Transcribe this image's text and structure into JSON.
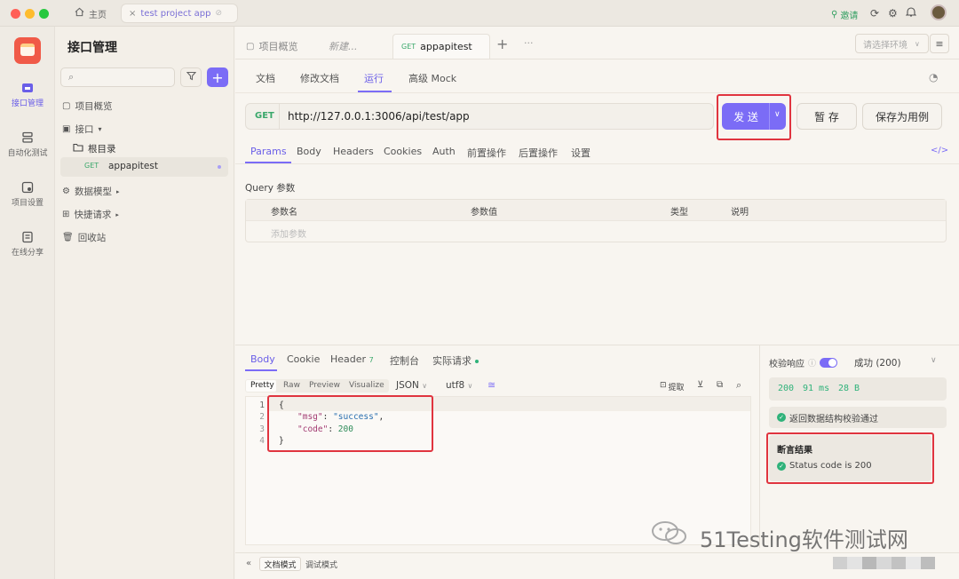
{
  "window": {
    "tab_home": "主页",
    "tab_project": "test project app",
    "invite": "邀请"
  },
  "rail": {
    "items": [
      {
        "label": "接口管理"
      },
      {
        "label": "自动化测试"
      },
      {
        "label": "项目设置"
      },
      {
        "label": "在线分享"
      }
    ]
  },
  "sidebar": {
    "title": "接口管理",
    "project_overview": "项目概览",
    "api": "接口",
    "root": "根目录",
    "endpoint_method": "GET",
    "endpoint_name": "appapitest",
    "data_models": "数据模型",
    "quick_requests": "快捷请求",
    "recycle": "回收站"
  },
  "tabs": {
    "overview": "项目概览",
    "new": "新建...",
    "active_method": "GET",
    "active_name": "appapitest",
    "env_placeholder": "请选择环境"
  },
  "subtabs": [
    "文档",
    "修改文档",
    "运行",
    "高级 Mock"
  ],
  "request": {
    "method": "GET",
    "url": "http://127.0.0.1:3006/api/test/app",
    "send": "发 送",
    "save_tmp": "暂 存",
    "save_case": "保存为用例"
  },
  "param_tabs": [
    "Params",
    "Body",
    "Headers",
    "Cookies",
    "Auth",
    "前置操作",
    "后置操作",
    "设置"
  ],
  "query": {
    "title": "Query 参数",
    "headers": [
      "参数名",
      "参数值",
      "类型",
      "说明"
    ],
    "add_placeholder": "添加参数"
  },
  "response": {
    "tabs": [
      "Body",
      "Cookie",
      "Header",
      "控制台",
      "实际请求"
    ],
    "header_count": "7",
    "formats": [
      "Pretty",
      "Raw",
      "Preview",
      "Visualize"
    ],
    "format": "JSON",
    "encoding": "utf8",
    "extract": "提取",
    "lines": [
      {
        "n": "1",
        "text": "{"
      },
      {
        "n": "2",
        "key": "\"msg\"",
        "val": "\"success\"",
        "tail": ","
      },
      {
        "n": "3",
        "key": "\"code\"",
        "num": "200",
        "tail": ""
      },
      {
        "n": "4",
        "text": "}"
      }
    ]
  },
  "validation": {
    "label": "校验响应",
    "status_select": "成功 (200)",
    "status_code": "200",
    "time": "91 ms",
    "size": "28 B",
    "schema_ok": "返回数据结构校验通过",
    "assert_title": "断言结果",
    "assert_item": "Status code is 200"
  },
  "footer": {
    "doc_mode": "文档模式",
    "debug_mode": "调试模式"
  },
  "watermark": "51Testing软件测试网",
  "colors": {
    "accent": "#7b6cf6",
    "success": "#2fb27a",
    "highlight": "#e0343f"
  }
}
